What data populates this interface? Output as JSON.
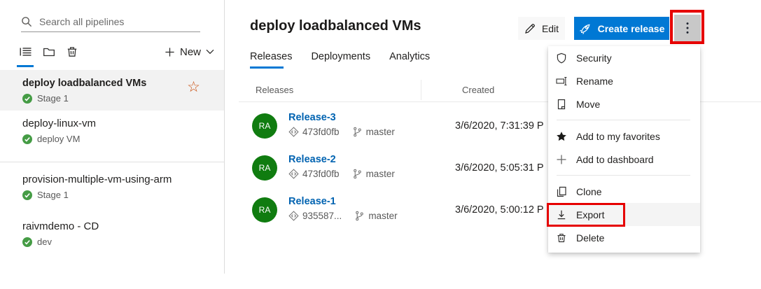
{
  "colors": {
    "accent_blue": "#0078d4",
    "link_blue": "#0063b1",
    "avatar_green": "#107c10",
    "status_check_green": "#459c45",
    "favorite_star_orange": "#ca5010",
    "annotation_red": "#e60000"
  },
  "sidebar": {
    "search": {
      "placeholder": "Search all pipelines"
    },
    "new_label": "New",
    "items": [
      {
        "name": "deploy loadbalanced VMs",
        "stage": "Stage 1"
      },
      {
        "name": "deploy-linux-vm",
        "stage": "deploy VM"
      },
      {
        "name": "provision-multiple-vm-using-arm",
        "stage": "Stage 1"
      },
      {
        "name": "raivmdemo - CD",
        "stage": "dev"
      }
    ]
  },
  "header": {
    "title": "deploy loadbalanced VMs",
    "edit_label": "Edit",
    "create_release_label": "Create release"
  },
  "tabs": [
    {
      "label": "Releases"
    },
    {
      "label": "Deployments"
    },
    {
      "label": "Analytics"
    }
  ],
  "table": {
    "columns": [
      "Releases",
      "Created"
    ],
    "rows": [
      {
        "avatar": "RA",
        "name": "Release-3",
        "commit": "473fd0fb",
        "branch": "master",
        "created": "3/6/2020, 7:31:39 P"
      },
      {
        "avatar": "RA",
        "name": "Release-2",
        "commit": "473fd0fb",
        "branch": "master",
        "created": "3/6/2020, 5:05:31 P"
      },
      {
        "avatar": "RA",
        "name": "Release-1",
        "commit": "935587...",
        "branch": "master",
        "created": "3/6/2020, 5:00:12 P"
      }
    ]
  },
  "menu": {
    "items": [
      {
        "label": "Security"
      },
      {
        "label": "Rename"
      },
      {
        "label": "Move"
      },
      {
        "label": "Add to my favorites"
      },
      {
        "label": "Add to dashboard"
      },
      {
        "label": "Clone"
      },
      {
        "label": "Export"
      },
      {
        "label": "Delete"
      }
    ]
  }
}
